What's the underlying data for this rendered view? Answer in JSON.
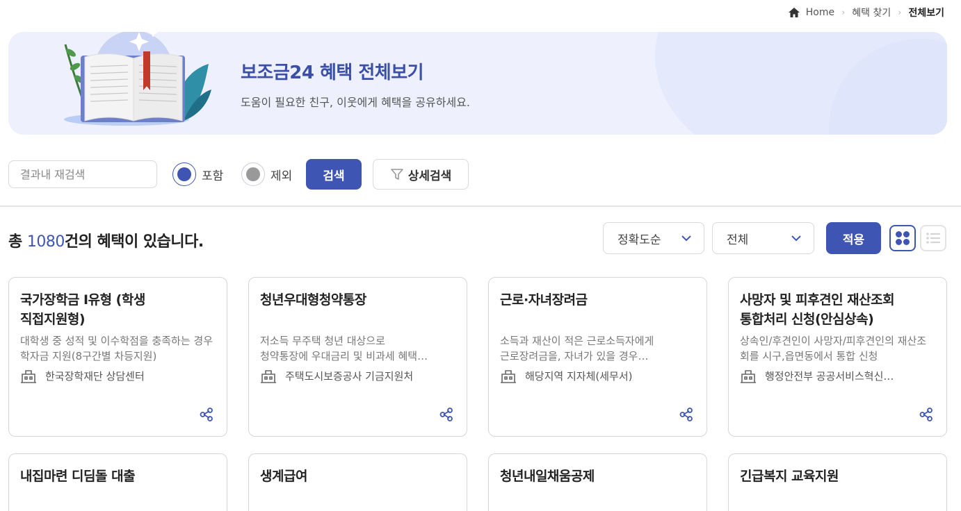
{
  "breadcrumb": {
    "home": "Home",
    "middle": "혜택 찾기",
    "current": "전체보기"
  },
  "banner": {
    "title": "보조금24 혜택 전체보기",
    "subtitle": "도움이 필요한 친구, 이웃에게 혜택을 공유하세요."
  },
  "search": {
    "placeholder": "결과내 재검색",
    "include_label": "포함",
    "exclude_label": "제외",
    "selected": "포함",
    "search_button": "검색",
    "detail_button": "상세검색"
  },
  "results": {
    "prefix": "총 ",
    "count": "1080",
    "suffix": "건의 혜택이 있습니다.",
    "sort_value": "정확도순",
    "filter_value": "전체",
    "apply_button": "적용",
    "view_mode": "grid"
  },
  "colors": {
    "accent": "#3f55b3",
    "banner_bg": "#eef1fd"
  },
  "cards": [
    {
      "title": "국가장학금 Ⅰ유형 (학생\n직접지원형)",
      "desc": "대학생 중 성적 및 이수학점을 충족하는 경우 학자금 지원(8구간별 차등지원)",
      "org": "한국장학재단 상담센터"
    },
    {
      "title": "청년우대형청약통장",
      "desc": "저소득 무주택 청년 대상으로\n청약통장에 우대금리 및 비과세 혜택…",
      "org": "주택도시보증공사 기금지원처"
    },
    {
      "title": "근로·자녀장려금",
      "desc": "소득과 재산이 적은 근로소득자에게\n근로장려금을, 자녀가 있을 경우…",
      "org": "해당지역 지자체(세무서)"
    },
    {
      "title": "사망자 및 피후견인 재산조회\n통합처리 신청(안심상속)",
      "desc": "상속인/후견인이 사망자/피후견인의 재산조회를 시구,읍면동에서 통합 신청",
      "org": "행정안전부 공공서비스혁신…"
    },
    {
      "title": "내집마련 디딤돌 대출",
      "desc": "",
      "org": ""
    },
    {
      "title": "생계급여",
      "desc": "",
      "org": ""
    },
    {
      "title": "청년내일채움공제",
      "desc": "",
      "org": ""
    },
    {
      "title": "긴급복지 교육지원",
      "desc": "",
      "org": ""
    }
  ],
  "icons": {
    "home": "home-icon",
    "filter": "filter-icon",
    "org": "building-icon",
    "share": "share-icon",
    "grid_view": "grid-view-icon",
    "list_view": "list-view-icon",
    "chevron": "chevron-down-icon"
  }
}
